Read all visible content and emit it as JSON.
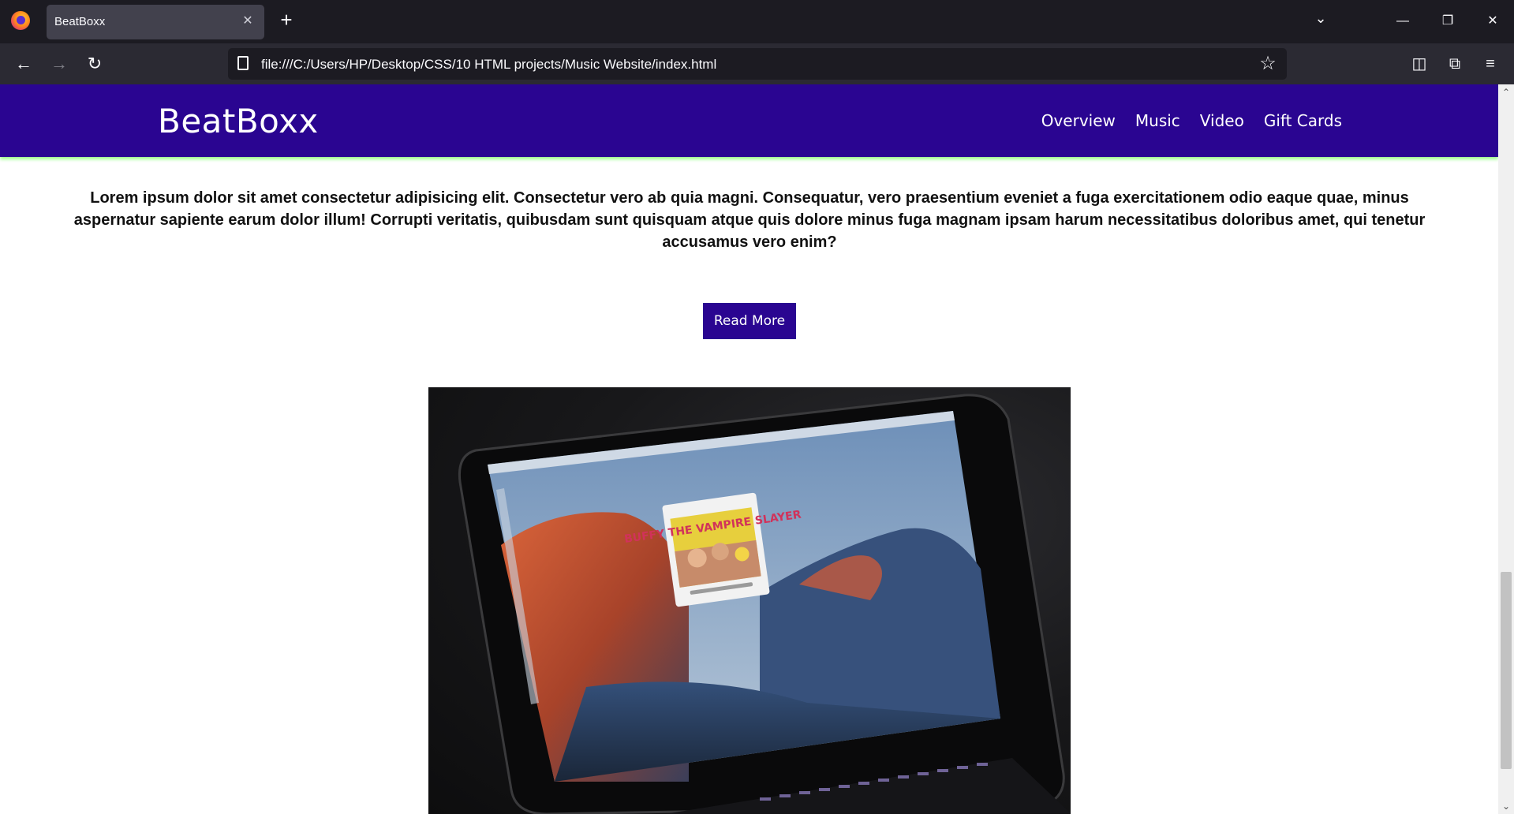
{
  "browser": {
    "tab_title": "BeatBoxx",
    "tab_close": "✕",
    "new_tab": "+",
    "tab_list": "⌄",
    "minimize": "—",
    "restore": "❐",
    "close": "✕",
    "back": "←",
    "forward": "→",
    "reload": "↻",
    "url": "file:///C:/Users/HP/Desktop/CSS/10 HTML projects/Music Website/index.html",
    "bookmark": "☆",
    "pocket": "◫",
    "extensions": "⧉",
    "menu": "≡"
  },
  "site": {
    "brand": "BeatBoxx",
    "nav": [
      "Overview",
      "Music",
      "Video",
      "Gift Cards"
    ],
    "intro_text": "Lorem ipsum dolor sit amet consectetur adipisicing elit. Consectetur vero ab quia magni. Consequatur, vero praesentium eveniet a fuga exercitationem odio eaque quae, minus aspernatur sapiente earum dolor illum! Corrupti veritatis, quibusdam sunt quisquam atque quis dolore minus fuga magnam ipsam harum necessitatibus doloribus amet, qui tenetur accusamus vero enim?",
    "read_more": "Read More",
    "laptop_album_title": "BUFFY THE VAMPIRE SLAYER",
    "accent_color": "#2a0591",
    "header_shadow_color": "#9cff8c"
  },
  "scrollbar": {
    "up": "⌃",
    "down": "⌄"
  }
}
